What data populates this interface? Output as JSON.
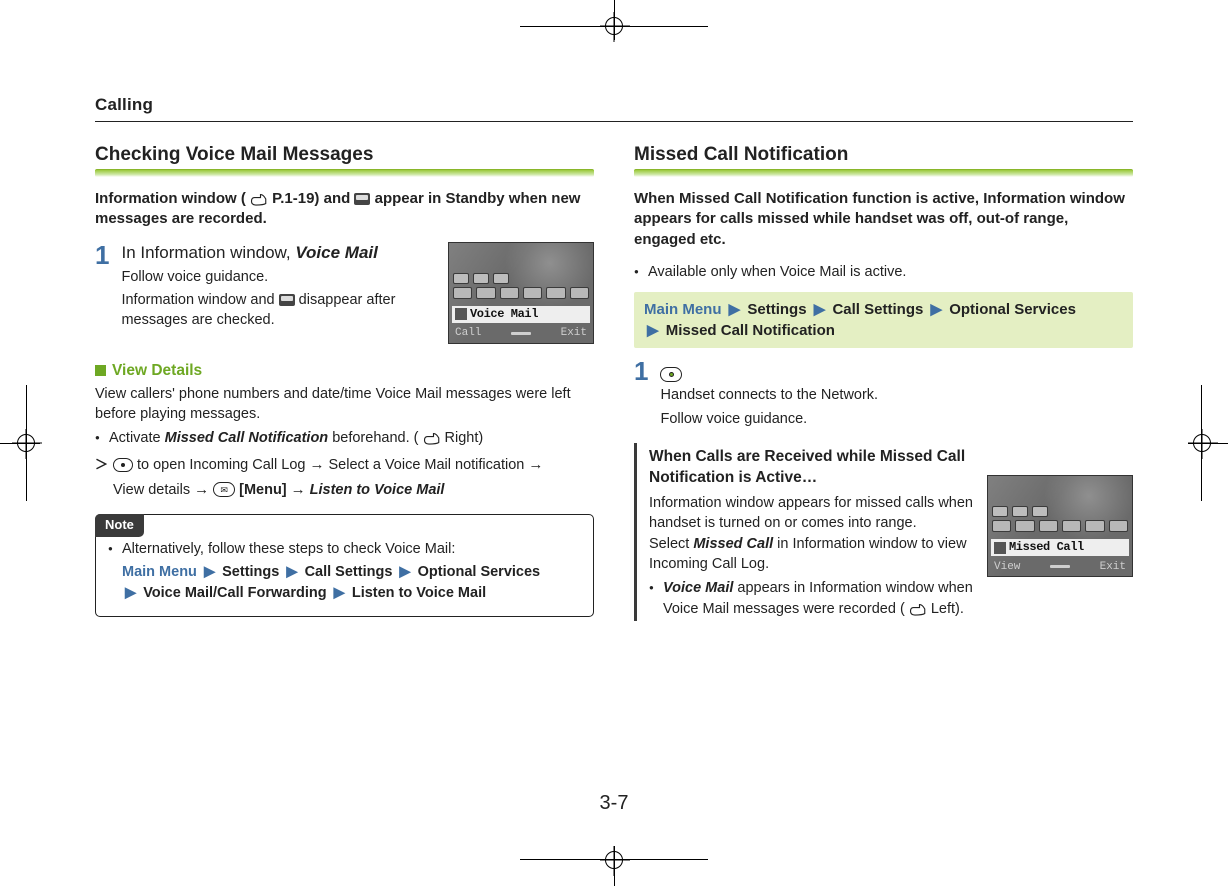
{
  "header": "Calling",
  "left": {
    "title": "Checking Voice Mail Messages",
    "intro_pre": "Information window (",
    "intro_ref": "P.1-19) and ",
    "intro_post": " appear in Standby when new messages are recorded.",
    "step1_num": "1",
    "step1_line_pre": "In Information window, ",
    "step1_line_bold": "Voice Mail",
    "step1_sub1": "Follow voice guidance.",
    "step1_sub2_pre": "Information window and ",
    "step1_sub2_post": " disappear after messages are checked.",
    "phone_label": "Voice Mail",
    "phone_soft_left": "Call",
    "phone_soft_right": "Exit",
    "view_details_title": "View Details",
    "view_details_body": "View callers' phone numbers and date/time Voice Mail messages were left before playing messages.",
    "bullet_activate_pre": "Activate ",
    "bullet_activate_bold": "Missed Call Notification",
    "bullet_activate_post": " beforehand. (",
    "bullet_activate_ref": "Right)",
    "angle_open": " to open Incoming Call Log ",
    "angle_select": " Select a Voice Mail notification ",
    "angle_view": " View details ",
    "angle_menu": "[Menu] ",
    "angle_listen": "Listen to Voice Mail",
    "note_label": "Note",
    "note_intro": "Alternatively, follow these steps to check Voice Mail:",
    "path_mainmenu": "Main Menu",
    "path_settings": "Settings",
    "path_callsettings": "Call Settings",
    "path_optional": "Optional Services",
    "path_vm": "Voice Mail/Call Forwarding",
    "path_listen": "Listen to Voice Mail"
  },
  "right": {
    "title": "Missed Call Notification",
    "intro": "When Missed Call Notification function is active, Information window appears for calls missed while handset was off, out-of range, engaged etc.",
    "bullet1": "Available only when Voice Mail is active.",
    "path_mainmenu": "Main Menu",
    "path_settings": "Settings",
    "path_callsettings": "Call Settings",
    "path_optional": "Optional Services",
    "path_mcn": "Missed Call Notification",
    "step1_num": "1",
    "step1_sub1": "Handset connects to the Network.",
    "step1_sub2": "Follow voice guidance.",
    "tip_title": "When Calls are Received while Missed Call Notification is Active…",
    "tip_body1": "Information window appears for missed calls when handset is turned on or comes into range.",
    "tip_body2_pre": "Select ",
    "tip_body2_bold": "Missed Call",
    "tip_body2_post": " in Information window to view Incoming Call Log.",
    "tip_bullet_bold": "Voice Mail",
    "tip_bullet_mid": " appears in Information window when Voice Mail messages were recorded (",
    "tip_bullet_ref": "Left).",
    "phone_label": "Missed Call",
    "phone_soft_left": "View",
    "phone_soft_right": "Exit"
  },
  "page_number": "3-7",
  "chevron": "▶"
}
